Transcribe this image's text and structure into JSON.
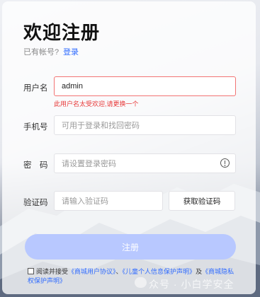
{
  "header": {
    "title": "欢迎注册",
    "have_account": "已有帐号?",
    "login_link": "登录"
  },
  "form": {
    "username": {
      "label": "用户名",
      "value": "admin",
      "error": "此用户名太受欢迎,请更换一个"
    },
    "phone": {
      "label": "手机号",
      "placeholder": "可用于登录和找回密码"
    },
    "password": {
      "label": "密　码",
      "placeholder": "请设置登录密码"
    },
    "code": {
      "label": "验证码",
      "placeholder": "请输入验证码",
      "button": "获取验证码"
    },
    "submit": "注册"
  },
  "agreement": {
    "prefix": "阅读并接受",
    "link1": "《商城用户协议》",
    "sep": "、",
    "link2": "《儿童个人信息保护声明》",
    "and": "及",
    "link3": "《商城隐私权保护声明》"
  },
  "watermark": "众号 · 小白学安全",
  "colors": {
    "accent": "#2f6bff",
    "error": "#e83a3a",
    "submit_bg": "#b8c8ff"
  }
}
